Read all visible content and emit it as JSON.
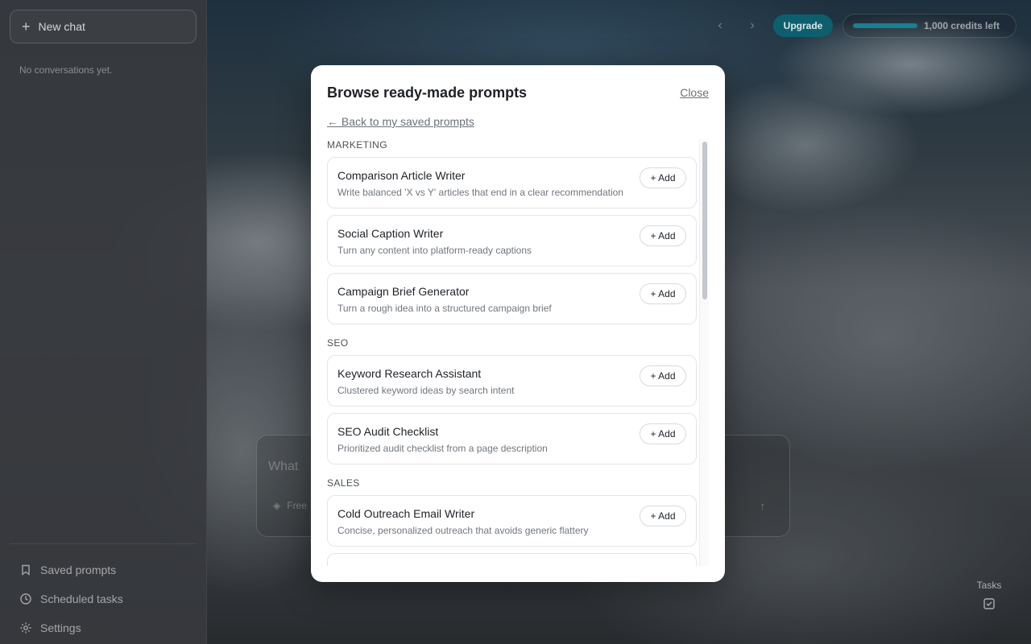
{
  "sidebar": {
    "new_chat_label": "New chat",
    "empty_note": "No conversations yet.",
    "nav": [
      {
        "label": "Saved prompts",
        "icon": "bookmark-icon"
      },
      {
        "label": "Scheduled tasks",
        "icon": "clock-icon"
      },
      {
        "label": "Settings",
        "icon": "gear-icon"
      }
    ]
  },
  "topbar": {
    "upgrade_label": "Upgrade",
    "credits_label": "1,000 credits left",
    "credits_fraction": 1.0,
    "accent": "#0e5f6e"
  },
  "composer": {
    "placeholder": "What",
    "mode_label": "Free"
  },
  "tasks": {
    "label": "Tasks"
  },
  "modal": {
    "title": "Browse ready-made prompts",
    "close_label": "Close",
    "back_label": "← Back to my saved prompts",
    "add_label": "+ Add",
    "sections": [
      {
        "label": "MARKETING",
        "items": [
          {
            "title": "Comparison Article Writer",
            "desc": "Write balanced 'X vs Y' articles that end in a clear recommendation"
          },
          {
            "title": "Social Caption Writer",
            "desc": "Turn any content into platform-ready captions"
          },
          {
            "title": "Campaign Brief Generator",
            "desc": "Turn a rough idea into a structured campaign brief"
          }
        ]
      },
      {
        "label": "SEO",
        "items": [
          {
            "title": "Keyword Research Assistant",
            "desc": "Clustered keyword ideas by search intent"
          },
          {
            "title": "SEO Audit Checklist",
            "desc": "Prioritized audit checklist from a page description"
          }
        ]
      },
      {
        "label": "SALES",
        "items": [
          {
            "title": "Cold Outreach Email Writer",
            "desc": "Concise, personalized outreach that avoids generic flattery"
          },
          {
            "title": "",
            "desc": ""
          }
        ]
      }
    ]
  }
}
